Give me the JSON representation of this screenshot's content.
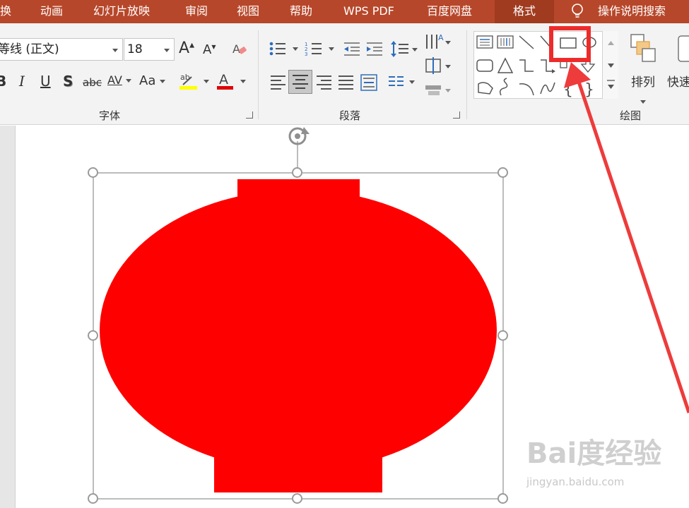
{
  "menu": {
    "items": [
      "换",
      "动画",
      "幻灯片放映",
      "审阅",
      "视图",
      "帮助",
      "WPS PDF",
      "百度网盘",
      "格式",
      "操作说明搜索"
    ],
    "active": "格式"
  },
  "font_group": {
    "label": "字体",
    "font_name": "等线 (正文)",
    "font_size": "18",
    "change_case": "Aa",
    "strikethrough": "abc",
    "char_spacing": "AV",
    "highlight_letters": "ab",
    "font_color_letter": "A"
  },
  "paragraph_group": {
    "label": "段落"
  },
  "drawing_group": {
    "label": "绘图",
    "arrange_label": "排列",
    "quick_styles_label": "快速"
  },
  "watermark": {
    "brand": "Bai度经验",
    "url": "jingyan.baidu.com"
  },
  "colors": {
    "menubar": "#b7472a",
    "shape_fill": "#ff0000",
    "highlight_box": "#ee2b2b",
    "arrow": "#ee3b3b"
  }
}
